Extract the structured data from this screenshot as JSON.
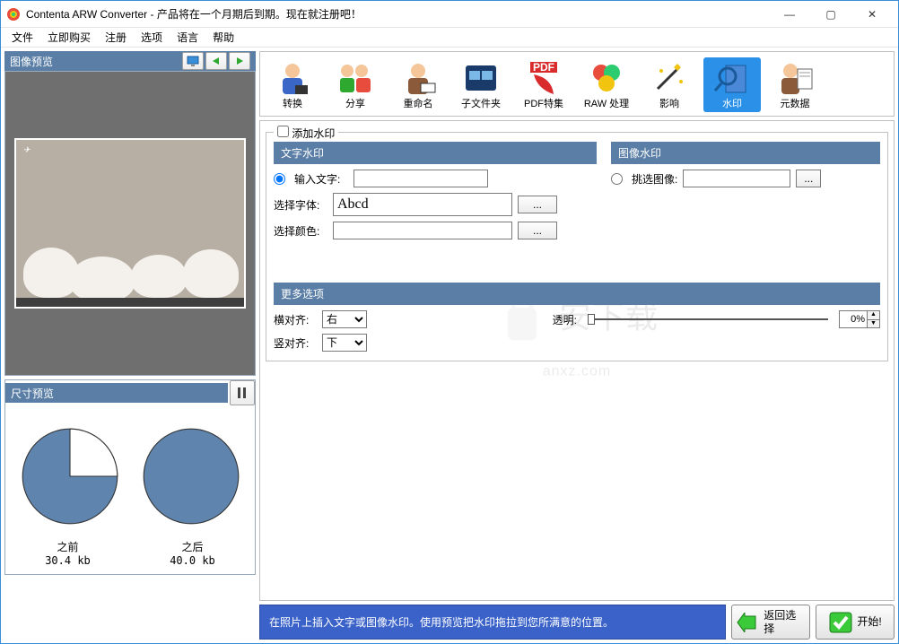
{
  "window": {
    "title": "Contenta ARW Converter  - 产品将在一个月期后到期。现在就注册吧！",
    "min": "—",
    "max": "▢",
    "close": "✕"
  },
  "menu": [
    "文件",
    "立即购买",
    "注册",
    "选项",
    "语言",
    "帮助"
  ],
  "left": {
    "preview_title": "图像预览",
    "size_title": "尺寸预览",
    "before_label": "之前",
    "after_label": "之后",
    "before_size": "30.4 kb",
    "after_size": "40.0 kb"
  },
  "toolbar": [
    {
      "id": "convert",
      "label": "转换"
    },
    {
      "id": "share",
      "label": "分享"
    },
    {
      "id": "rename",
      "label": "重命名"
    },
    {
      "id": "subfolder",
      "label": "子文件夹"
    },
    {
      "id": "pdf",
      "label": "PDF特集"
    },
    {
      "id": "raw",
      "label": "RAW 处理"
    },
    {
      "id": "effect",
      "label": "影响"
    },
    {
      "id": "watermark",
      "label": "水印",
      "selected": true
    },
    {
      "id": "metadata",
      "label": "元数据"
    }
  ],
  "content": {
    "add_watermark": "添加水印",
    "text_wm_title": "文字水印",
    "image_wm_title": "图像水印",
    "input_text_label": "输入文字:",
    "select_image_label": "挑选图像:",
    "select_font_label": "选择字体:",
    "font_sample": "Abcd",
    "select_color_label": "选择颜色:",
    "more_title": "更多选项",
    "halign_label": "横对齐:",
    "halign_value": "右",
    "valign_label": "竖对齐:",
    "valign_value": "下",
    "opacity_label": "透明:",
    "opacity_value": "0%"
  },
  "footer": {
    "info": "在照片上插入文字或图像水印。使用预览把水印拖拉到您所满意的位置。",
    "back_label": "返回选择",
    "start_label": "开始!"
  },
  "chart_data": [
    {
      "type": "pie",
      "title": "之前",
      "values": [
        75,
        25
      ],
      "colors": [
        "#5f84ae",
        "#ffffff"
      ]
    },
    {
      "type": "pie",
      "title": "之后",
      "values": [
        100
      ],
      "colors": [
        "#5f84ae"
      ]
    }
  ]
}
